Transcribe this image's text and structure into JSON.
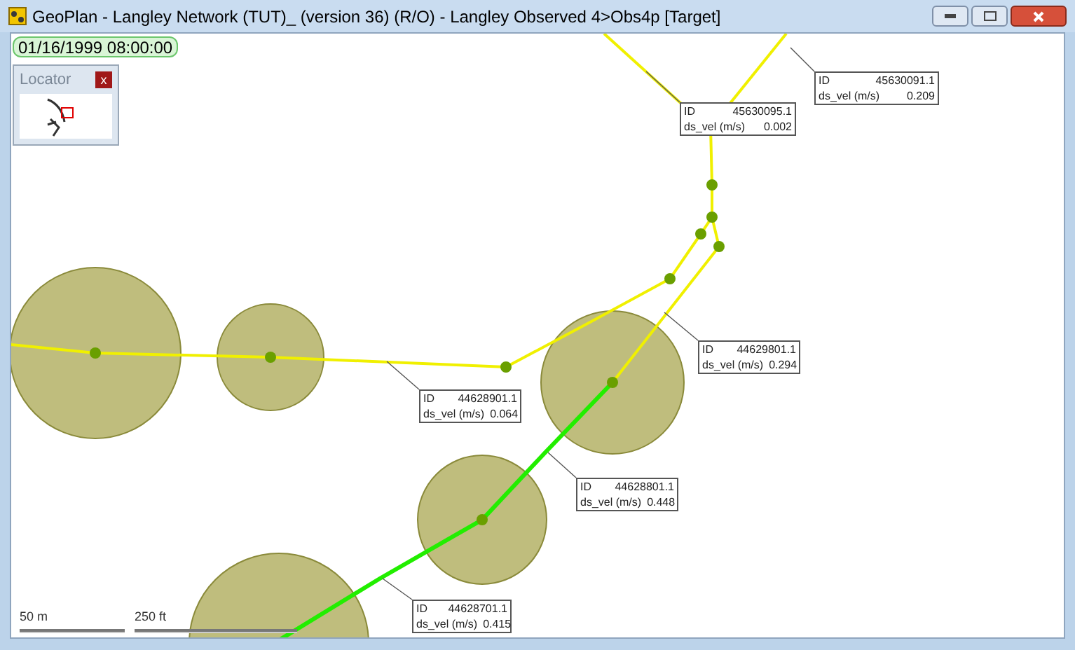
{
  "window": {
    "title": "GeoPlan - Langley Network (TUT)_ (version 36) (R/O) - Langley Observed 4>Obs4p  [Target]"
  },
  "timestamp": "01/16/1999 08:00:00",
  "locator": {
    "title": "Locator",
    "close": "x"
  },
  "labels": [
    {
      "id_label": "ID",
      "id": "45630095.1",
      "var_label": "ds_vel (m/s)",
      "value": "0.002"
    },
    {
      "id_label": "ID",
      "id": "45630091.1",
      "var_label": "ds_vel (m/s)",
      "value": "0.209"
    },
    {
      "id_label": "ID",
      "id": "44629801.1",
      "var_label": "ds_vel (m/s)",
      "value": "0.294"
    },
    {
      "id_label": "ID",
      "id": "44628901.1",
      "var_label": "ds_vel (m/s)",
      "value": "0.064"
    },
    {
      "id_label": "ID",
      "id": "44628801.1",
      "var_label": "ds_vel (m/s)",
      "value": "0.448"
    },
    {
      "id_label": "ID",
      "id": "44628701.1",
      "var_label": "ds_vel (m/s)",
      "value": "0.415"
    }
  ],
  "scale_bars": [
    {
      "label": "50 m"
    },
    {
      "label": "250 ft"
    }
  ]
}
